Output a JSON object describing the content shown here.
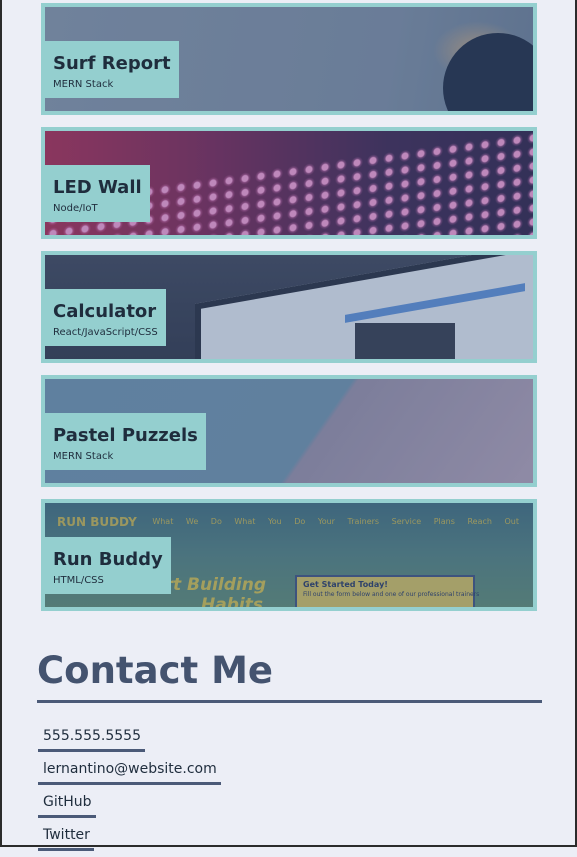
{
  "projects": [
    {
      "title": "Surf Report",
      "tech": "MERN Stack"
    },
    {
      "title": "LED Wall",
      "tech": "Node/IoT"
    },
    {
      "title": "Calculator",
      "tech": "React/JavaScript/CSS"
    },
    {
      "title": "Pastel Puzzels",
      "tech": "MERN Stack"
    },
    {
      "title": "Run Buddy",
      "tech": "HTML/CSS"
    }
  ],
  "runbuddy_preview": {
    "logo": "RUN BUDDY",
    "nav": "What We Do  What You Do  Your Trainers  Service Plans  Reach Out",
    "hero_line1": "tart Building",
    "hero_line2": "Habits",
    "box_title": "Get Started Today!",
    "box_text": "Fill out the form below and one of our professional trainers"
  },
  "contact": {
    "heading": "Contact Me",
    "links": [
      "555.555.5555",
      "lernantino@website.com",
      "GitHub",
      "Twitter"
    ]
  },
  "colors": {
    "background": "#eceef6",
    "card_border": "#94cfcf",
    "label_bg": "#94cfcf",
    "heading": "#44536f",
    "underline": "#4b5a78"
  }
}
